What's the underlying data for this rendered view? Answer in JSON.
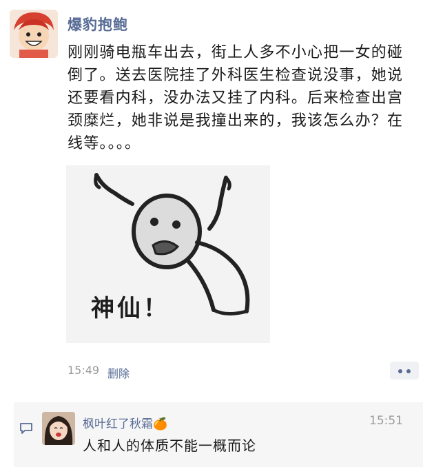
{
  "post": {
    "author": "爆豹抱鲍",
    "text": "刚刚骑电瓶车出去，街上人多不小心把一女的碰倒了。送去医院挂了外科医生检查说没事，她说还要看内科，没办法又挂了内科。后来检查出宫颈糜烂，她非说是我撞出来的，我该怎么办？在线等。。。。",
    "image_caption": "神仙！",
    "time": "15:49",
    "delete_label": "删除"
  },
  "comment": {
    "author": "枫叶红了秋霜",
    "author_emoji": "🍊",
    "time": "15:51",
    "text": "人和人的体质不能一概而论"
  },
  "colors": {
    "link_blue": "#576b95",
    "time_gray": "#9a9a9a",
    "comment_bg": "#f6f6f6"
  }
}
